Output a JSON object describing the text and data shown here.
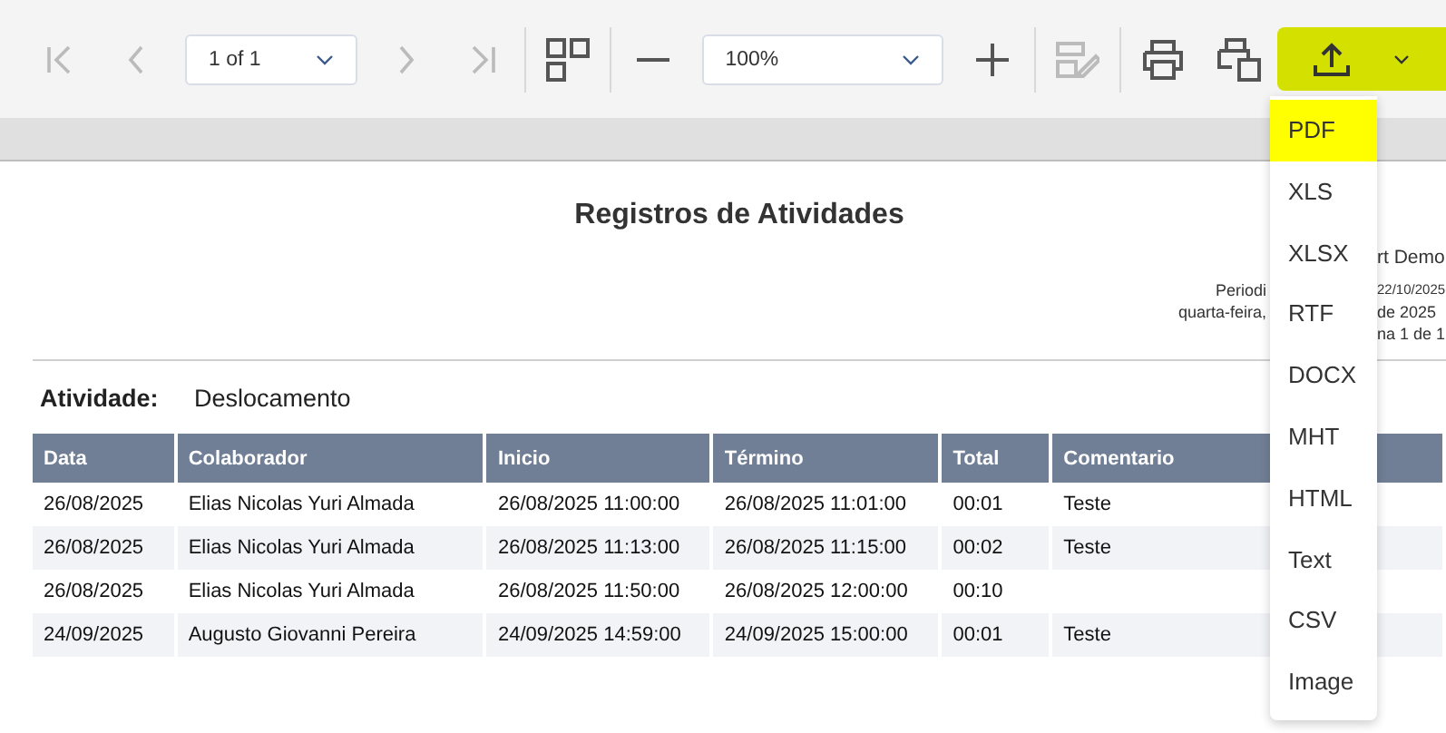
{
  "toolbar": {
    "buttons": [
      {
        "kind": "first",
        "disabled": true
      },
      {
        "kind": "prev",
        "disabled": true
      },
      {
        "kind": "page-select",
        "value": "1 of 1"
      },
      {
        "kind": "next",
        "disabled": true
      },
      {
        "kind": "last",
        "disabled": true
      },
      {
        "kind": "separator"
      },
      {
        "kind": "multipage",
        "disabled": false
      },
      {
        "kind": "separator"
      },
      {
        "kind": "zoom-out",
        "disabled": false
      },
      {
        "kind": "zoom-select",
        "value": "100%"
      },
      {
        "kind": "zoom-in",
        "disabled": false
      },
      {
        "kind": "separator"
      },
      {
        "kind": "edit",
        "disabled": true
      },
      {
        "kind": "separator"
      },
      {
        "kind": "print",
        "disabled": false
      },
      {
        "kind": "print-page",
        "disabled": false
      },
      {
        "kind": "export"
      }
    ]
  },
  "export_menu": {
    "items": [
      {
        "label": "PDF",
        "selected": true
      },
      {
        "label": "XLS",
        "selected": false
      },
      {
        "label": "XLSX",
        "selected": false
      },
      {
        "label": "RTF",
        "selected": false
      },
      {
        "label": "DOCX",
        "selected": false
      },
      {
        "label": "MHT",
        "selected": false
      },
      {
        "label": "HTML",
        "selected": false
      },
      {
        "label": "Text",
        "selected": false
      },
      {
        "label": "CSV",
        "selected": false
      },
      {
        "label": "Image",
        "selected": false
      }
    ]
  },
  "report": {
    "title": "Registros de Atividades",
    "header_left": [
      "Periodi",
      "quarta-feira,"
    ],
    "header_right": [
      "rt Demo",
      "22/10/2025",
      "de 2025",
      "na 1 de 1"
    ],
    "activity_label": "Atividade:",
    "activity_value": "Deslocamento",
    "columns": [
      "Data",
      "Colaborador",
      "Inicio",
      "Término",
      "Total",
      "Comentario"
    ],
    "rows": [
      [
        "26/08/2025",
        "Elias Nicolas Yuri Almada",
        "26/08/2025 11:00:00",
        "26/08/2025 11:01:00",
        "00:01",
        "Teste"
      ],
      [
        "26/08/2025",
        "Elias Nicolas Yuri Almada",
        "26/08/2025 11:13:00",
        "26/08/2025 11:15:00",
        "00:02",
        "Teste"
      ],
      [
        "26/08/2025",
        "Elias Nicolas Yuri Almada",
        "26/08/2025 11:50:00",
        "26/08/2025 12:00:00",
        "00:10",
        ""
      ],
      [
        "24/09/2025",
        "Augusto Giovanni Pereira",
        "24/09/2025 14:59:00",
        "24/09/2025 15:00:00",
        "00:01",
        "Teste"
      ]
    ]
  }
}
